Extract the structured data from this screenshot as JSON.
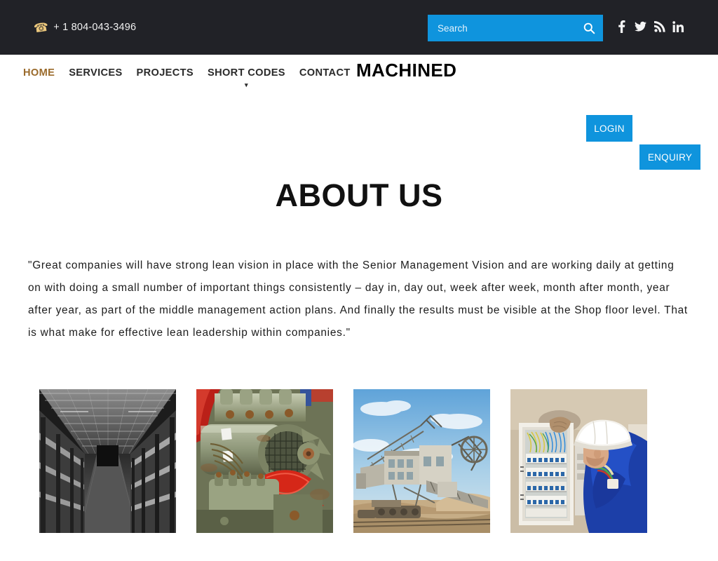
{
  "topbar": {
    "phone_icon": "phone-icon",
    "phone": "+ 1 804-043-3496",
    "search": {
      "placeholder": "Search",
      "value": "",
      "button_icon": "search-icon"
    },
    "social": [
      {
        "name": "facebook",
        "glyph": "f"
      },
      {
        "name": "twitter",
        "glyph": "t"
      },
      {
        "name": "rss",
        "glyph": "r"
      },
      {
        "name": "linkedin",
        "glyph": "in"
      }
    ],
    "background_color": "#212227"
  },
  "nav": {
    "logo": "MACHINED",
    "items": [
      {
        "label": "HOME",
        "active": true,
        "has_dropdown": false
      },
      {
        "label": "SERVICES",
        "active": false,
        "has_dropdown": false
      },
      {
        "label": "PROJECTS",
        "active": false,
        "has_dropdown": false
      },
      {
        "label": "SHORT CODES",
        "active": false,
        "has_dropdown": true
      },
      {
        "label": "CONTACT",
        "active": false,
        "has_dropdown": false
      }
    ],
    "active_color": "#9a6a2b",
    "buttons": {
      "login": "LOGIN",
      "enquiry": "ENQUIRY",
      "color": "#0f94dd"
    },
    "dropdown_caret": "▾"
  },
  "main": {
    "title": "ABOUT US",
    "paragraph": "\"Great companies will have strong lean vision in place with the Senior Management Vision and are working daily at getting on with doing a small number of important things consistently – day in, day out, week after week, month after month, year after year, as part of the middle management action plans. And finally the results must be visible at the Shop floor level. That is what make for effective lean leadership within companies.\"",
    "gallery": [
      {
        "name": "warehouse-shelving-aisle",
        "alt": "Black and white warehouse racking aisle"
      },
      {
        "name": "diesel-engine",
        "alt": "Green rusted industrial diesel engine with red belt"
      },
      {
        "name": "bucket-wheel-excavator",
        "alt": "Large mining excavator machine under blue sky"
      },
      {
        "name": "electrician-panel",
        "alt": "Electrician in blue overalls and white hard hat at electrical panel"
      }
    ]
  }
}
